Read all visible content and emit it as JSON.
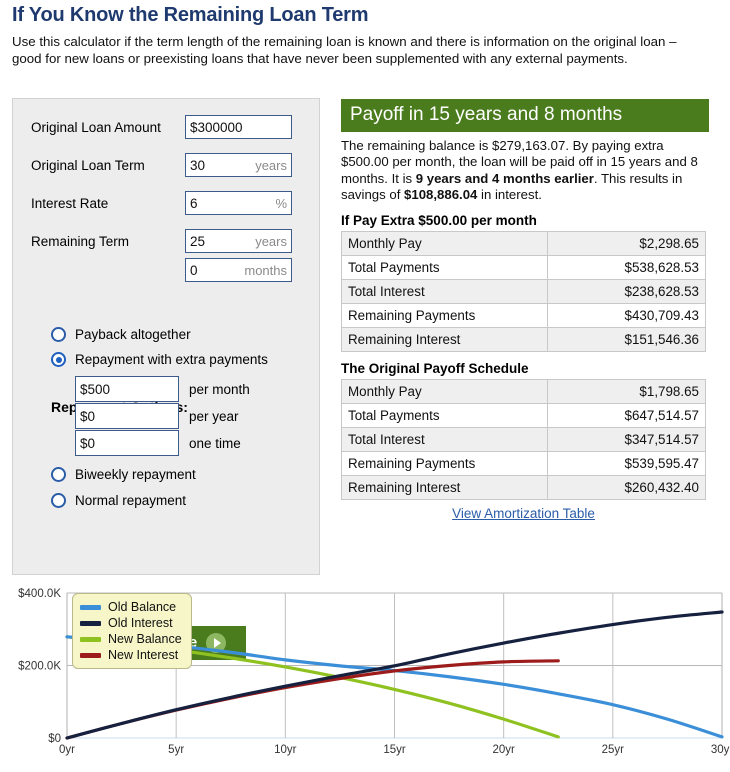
{
  "header": {
    "title": "If You Know the Remaining Loan Term",
    "description": "Use this calculator if the term length of the remaining loan is known and there is information on the original loan – good for new loans or preexisting loans that have never been supplemented with any external payments."
  },
  "form": {
    "fields": [
      {
        "label": "Original Loan Amount",
        "value": "$300000",
        "unit": ""
      },
      {
        "label": "Original Loan Term",
        "value": "30",
        "unit": "years"
      },
      {
        "label": "Interest Rate",
        "value": "6",
        "unit": "%"
      },
      {
        "label": "Remaining Term",
        "value": "25",
        "unit": "years"
      },
      {
        "label": "",
        "value": "0",
        "unit": "months"
      }
    ],
    "repayment_title": "Repayment Options:",
    "options": [
      {
        "label": "Payback altogether",
        "selected": false
      },
      {
        "label": "Repayment with extra payments",
        "selected": true
      },
      {
        "label": "Biweekly repayment",
        "selected": false
      },
      {
        "label": "Normal repayment",
        "selected": false
      }
    ],
    "extra_payments": [
      {
        "value": "$500",
        "label": "per month"
      },
      {
        "value": "$0",
        "label": "per year"
      },
      {
        "value": "$0",
        "label": "one time"
      }
    ],
    "calculate_label": "Calculate"
  },
  "results": {
    "headline": "Payoff in 15 years and 8 months",
    "summary_parts": [
      {
        "text": "The remaining balance is $279,163.07. By paying extra $500.00 per month, the loan will be paid off in 15 years and 8 months. It is ",
        "bold": false
      },
      {
        "text": "9 years and 4 months earlier",
        "bold": true
      },
      {
        "text": ". This results in savings of ",
        "bold": false
      },
      {
        "text": "$108,886.04",
        "bold": true
      },
      {
        "text": " in interest.",
        "bold": false
      }
    ],
    "table_extra": {
      "title": "If Pay Extra $500.00 per month",
      "rows": [
        {
          "key": "Monthly Pay",
          "value": "$2,298.65"
        },
        {
          "key": "Total Payments",
          "value": "$538,628.53"
        },
        {
          "key": "Total Interest",
          "value": "$238,628.53"
        },
        {
          "key": "Remaining Payments",
          "value": "$430,709.43"
        },
        {
          "key": "Remaining Interest",
          "value": "$151,546.36"
        }
      ]
    },
    "table_original": {
      "title": "The Original Payoff Schedule",
      "rows": [
        {
          "key": "Monthly Pay",
          "value": "$1,798.65"
        },
        {
          "key": "Total Payments",
          "value": "$647,514.57"
        },
        {
          "key": "Total Interest",
          "value": "$347,514.57"
        },
        {
          "key": "Remaining Payments",
          "value": "$539,595.47"
        },
        {
          "key": "Remaining Interest",
          "value": "$260,432.40"
        }
      ]
    },
    "amortization_link": "View Amortization Table"
  },
  "chart_data": {
    "type": "line",
    "title": "",
    "xlabel": "",
    "ylabel": "",
    "xlim": [
      0,
      30
    ],
    "ylim": [
      0,
      400000
    ],
    "xticks": [
      "0yr",
      "5yr",
      "10yr",
      "15yr",
      "20yr",
      "25yr",
      "30yr"
    ],
    "xtick_values": [
      0,
      5,
      10,
      15,
      20,
      25,
      30
    ],
    "yticks": [
      "$0",
      "$200.0K",
      "$400.0K"
    ],
    "ytick_values": [
      0,
      200000,
      400000
    ],
    "grid": true,
    "legend_position": "top-left",
    "colors": {
      "old_balance": "#3b8fd8",
      "old_interest": "#15213f",
      "new_balance": "#8fc220",
      "new_interest": "#9d1b1b"
    },
    "x": [
      0,
      2.5,
      5,
      7.5,
      10,
      12.5,
      15,
      17.5,
      20,
      22.5,
      25,
      27.5,
      30
    ],
    "series": [
      {
        "name": "Old Balance",
        "color": "#3b8fd8",
        "values": [
          279163,
          268000,
          254000,
          236500,
          215500,
          199000,
          186000,
          169000,
          148000,
          122000,
          92000,
          52000,
          3000
        ]
      },
      {
        "name": "Old Interest",
        "color": "#15213f",
        "values": [
          0,
          40000,
          78000,
          112000,
          143000,
          172000,
          199000,
          232000,
          262000,
          289000,
          313000,
          333000,
          347515
        ]
      },
      {
        "name": "New Balance",
        "color": "#8fc220",
        "values": [
          279163,
          262000,
          243000,
          221000,
          196000,
          167000,
          134000,
          96000,
          52000,
          3000,
          null,
          null,
          null
        ]
      },
      {
        "name": "New Interest",
        "color": "#9d1b1b",
        "values": [
          0,
          40000,
          77000,
          110000,
          139000,
          164000,
          185000,
          200000,
          210000,
          213000,
          null,
          null,
          null
        ]
      }
    ]
  }
}
